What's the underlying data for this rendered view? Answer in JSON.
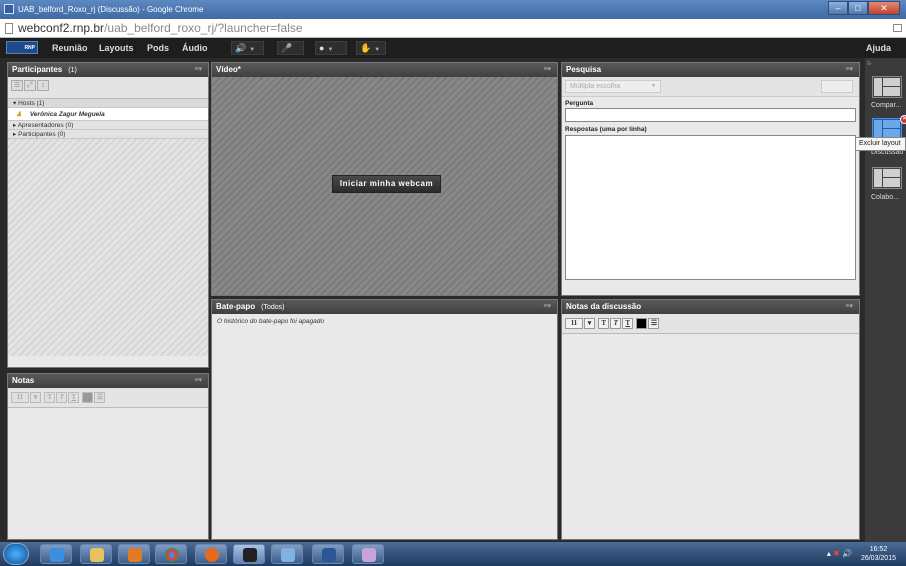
{
  "browser": {
    "title": "UAB_belford_Roxo_rj (Discussão) - Google Chrome",
    "url_host": "webconf2.rnp.br",
    "url_path": "/uab_belford_roxo_rj/?launcher=false"
  },
  "menu": {
    "logo": "RNP",
    "items": [
      "Reunião",
      "Layouts",
      "Pods",
      "Áudio"
    ],
    "help": "Ajuda"
  },
  "participants": {
    "title": "Participantes",
    "count": "(1)",
    "groups": [
      {
        "label": "Hosts (1)",
        "expanded": true
      },
      {
        "label": "Apresentadores (0)",
        "expanded": false
      },
      {
        "label": "Participantes (0)",
        "expanded": false
      }
    ],
    "host_name": "Verônica Zagur Meguela"
  },
  "video": {
    "title": "Vídeo*",
    "start_button": "Iniciar minha webcam"
  },
  "poll": {
    "title": "Pesquisa",
    "type_select": "Múltipla escolha",
    "question_label": "Pergunta",
    "answers_label": "Respostas (uma por linha)"
  },
  "notes": {
    "title": "Notas",
    "font_size": "11"
  },
  "chat": {
    "title": "Bate-papo",
    "scope": "(Todos)",
    "message": "O histórico do bate-papo foi apagado"
  },
  "discussion_notes": {
    "title": "Notas da discussão",
    "font_size": "11"
  },
  "layouts": {
    "items": [
      "Compar...",
      "Discussão",
      "Colabo..."
    ],
    "tooltip": "Excluir layout"
  },
  "taskbar": {
    "time": "16:52",
    "date": "26/03/2015"
  }
}
